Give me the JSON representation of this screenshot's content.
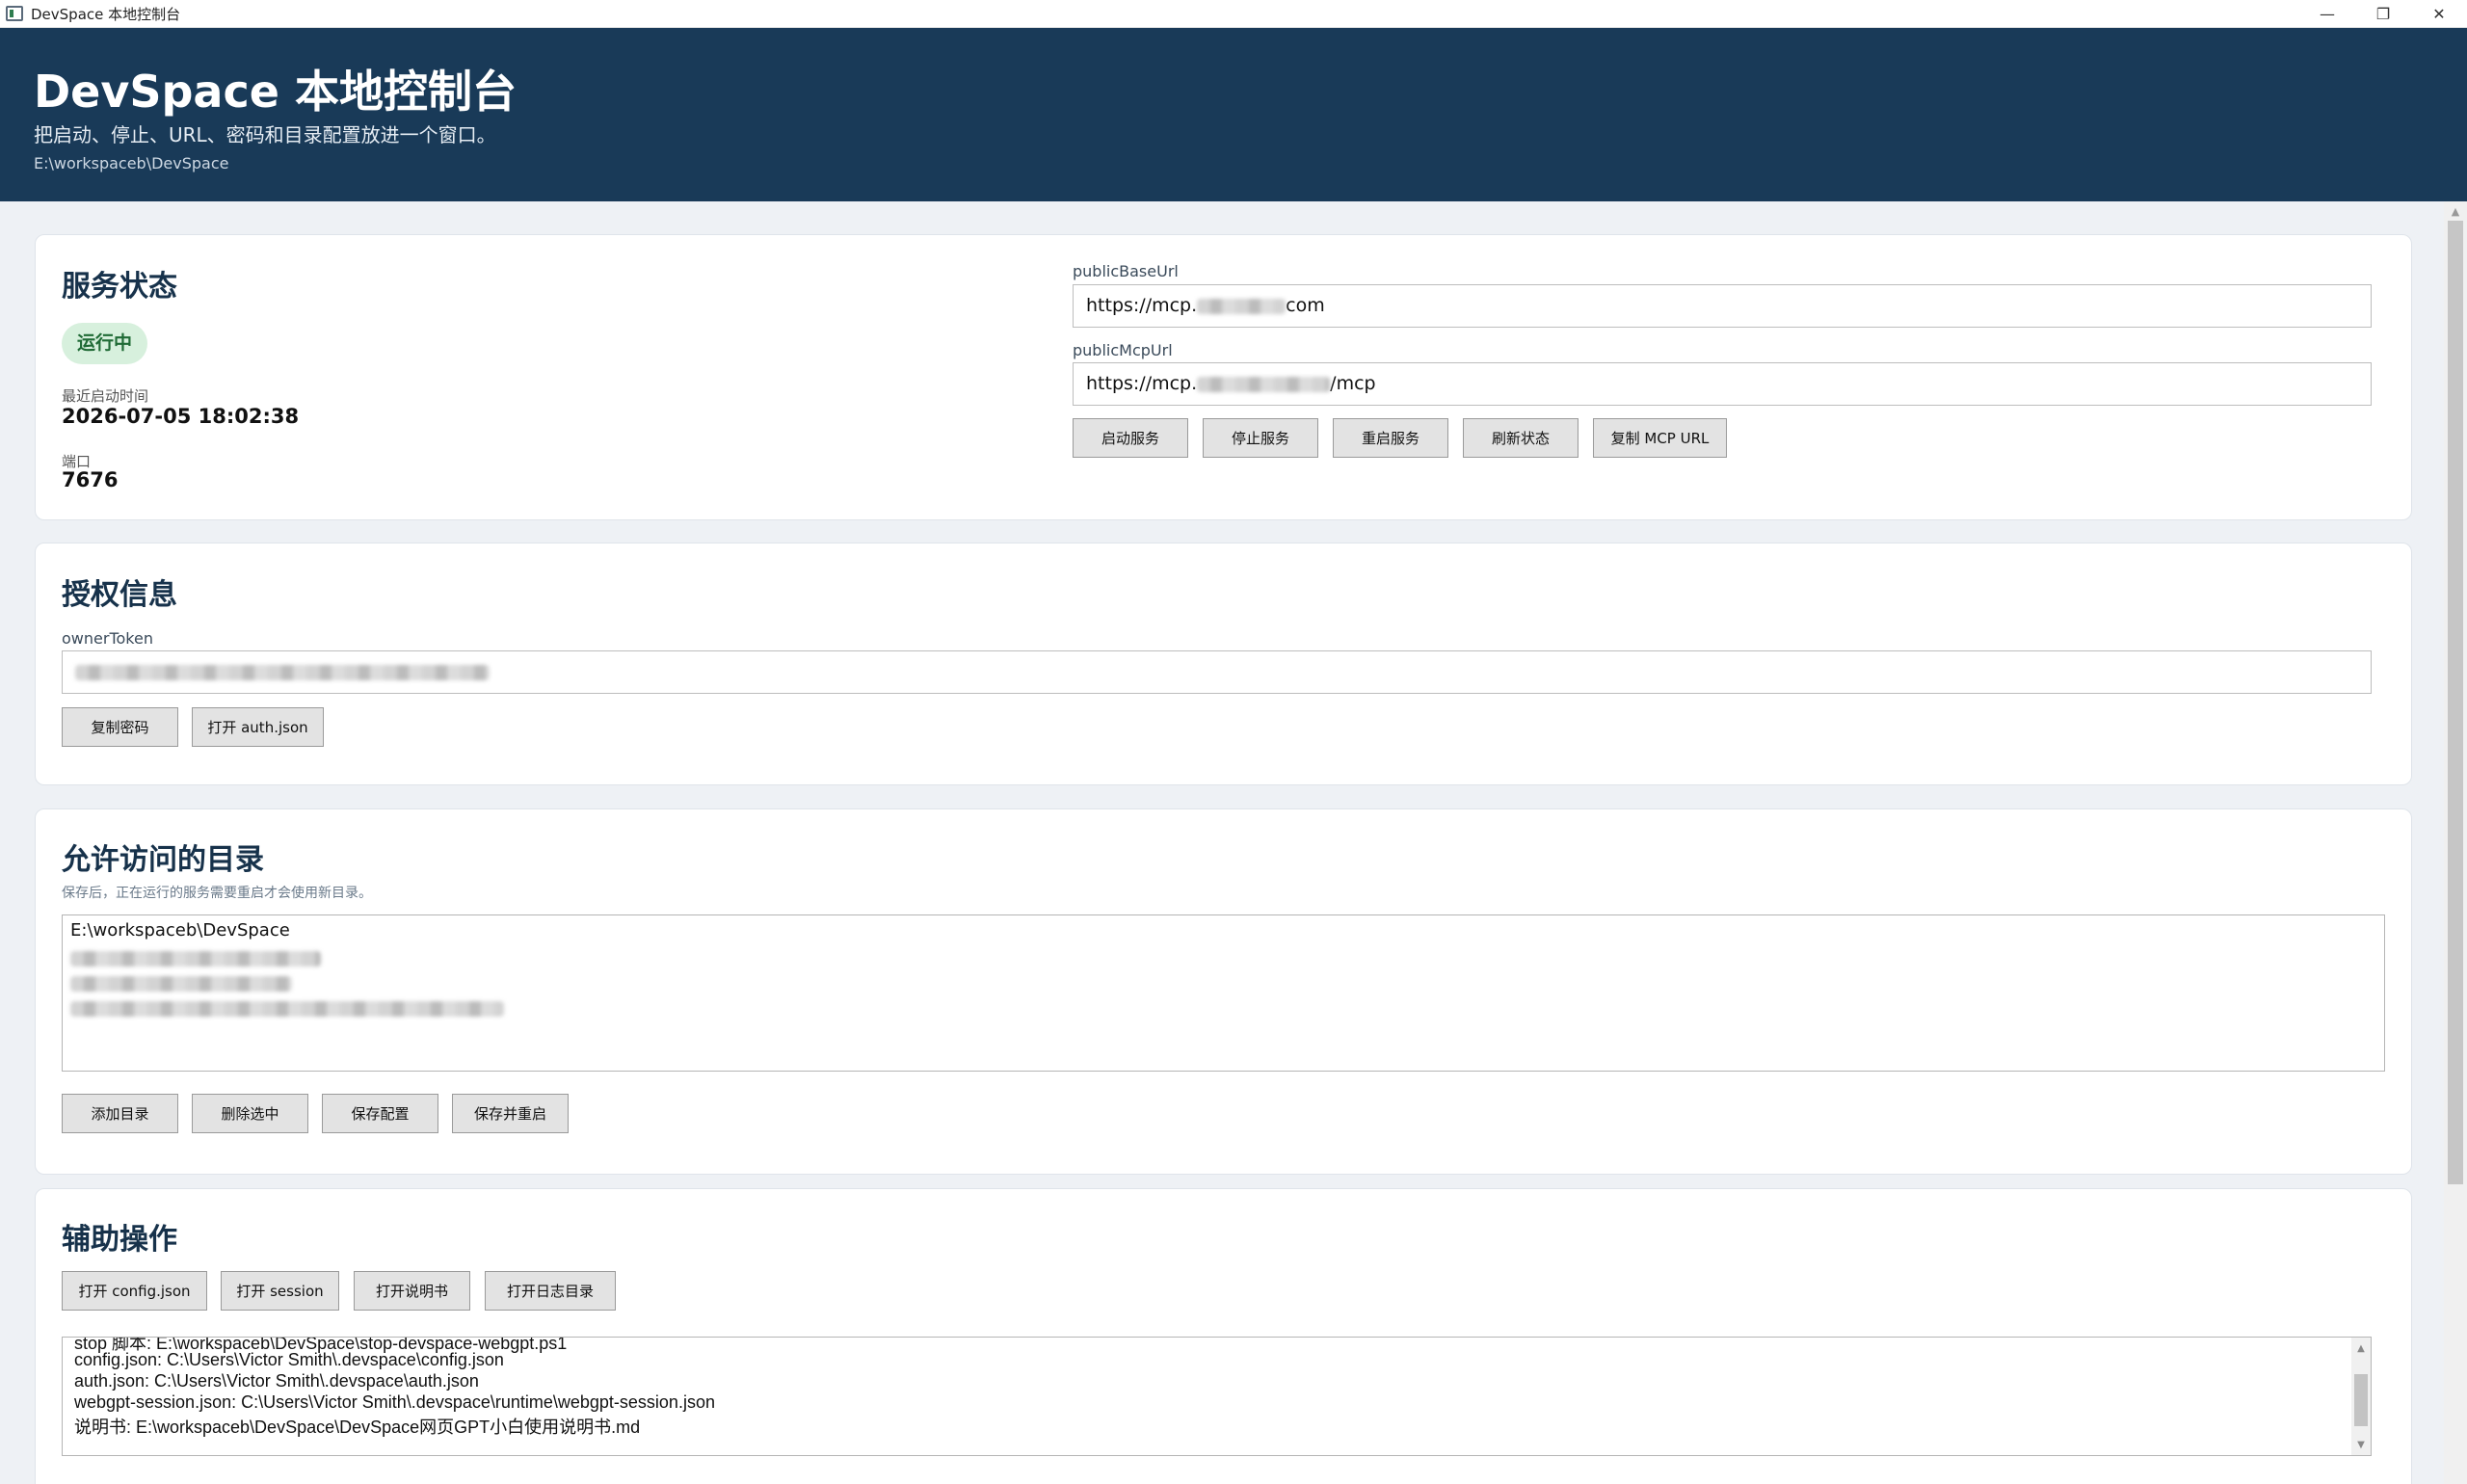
{
  "window": {
    "title": "DevSpace 本地控制台",
    "minimize_glyph": "—",
    "restore_glyph": "❐",
    "close_glyph": "✕"
  },
  "header": {
    "title": "DevSpace 本地控制台",
    "subtitle": "把启动、停止、URL、密码和目录配置放进一个窗口。",
    "path": "E:\\workspaceb\\DevSpace"
  },
  "service": {
    "title": "服务状态",
    "status_badge": "运行中",
    "status_color": "#1f6a35",
    "last_start_label": "最近启动时间",
    "last_start_value": "2026-07-05 18:02:38",
    "port_label": "端口",
    "port_value": "7676",
    "public_base_url_label": "publicBaseUrl",
    "public_base_url_prefix": "https://mcp.",
    "public_base_url_suffix": "com",
    "public_mcp_url_label": "publicMcpUrl",
    "public_mcp_url_prefix": "https://mcp.",
    "public_mcp_url_suffix": "/mcp",
    "buttons": {
      "start": "启动服务",
      "stop": "停止服务",
      "restart": "重启服务",
      "refresh": "刷新状态",
      "copy_mcp": "复制 MCP URL"
    }
  },
  "auth": {
    "title": "授权信息",
    "owner_token_label": "ownerToken",
    "buttons": {
      "copy_password": "复制密码",
      "open_auth": "打开 auth.json"
    }
  },
  "dirs": {
    "title": "允许访问的目录",
    "hint": "保存后，正在运行的服务需要重启才会使用新目录。",
    "items": [
      "E:\\workspaceb\\DevSpace"
    ],
    "buttons": {
      "add": "添加目录",
      "remove": "删除选中",
      "save": "保存配置",
      "save_restart": "保存并重启"
    }
  },
  "aux": {
    "title": "辅助操作",
    "buttons": {
      "open_config": "打开 config.json",
      "open_session": "打开 session",
      "open_manual": "打开说明书",
      "open_logs": "打开日志目录"
    },
    "log_lines": [
      "stop 脚本: E:\\workspaceb\\DevSpace\\stop-devspace-webgpt.ps1",
      "config.json: C:\\Users\\Victor Smith\\.devspace\\config.json",
      "auth.json: C:\\Users\\Victor Smith\\.devspace\\auth.json",
      "webgpt-session.json: C:\\Users\\Victor Smith\\.devspace\\runtime\\webgpt-session.json",
      "说明书: E:\\workspaceb\\DevSpace\\DevSpace网页GPT小白使用说明书.md"
    ]
  },
  "colors": {
    "header_bg": "#193a58",
    "page_bg": "#eef1f5",
    "badge_bg": "#d7f0dd"
  }
}
